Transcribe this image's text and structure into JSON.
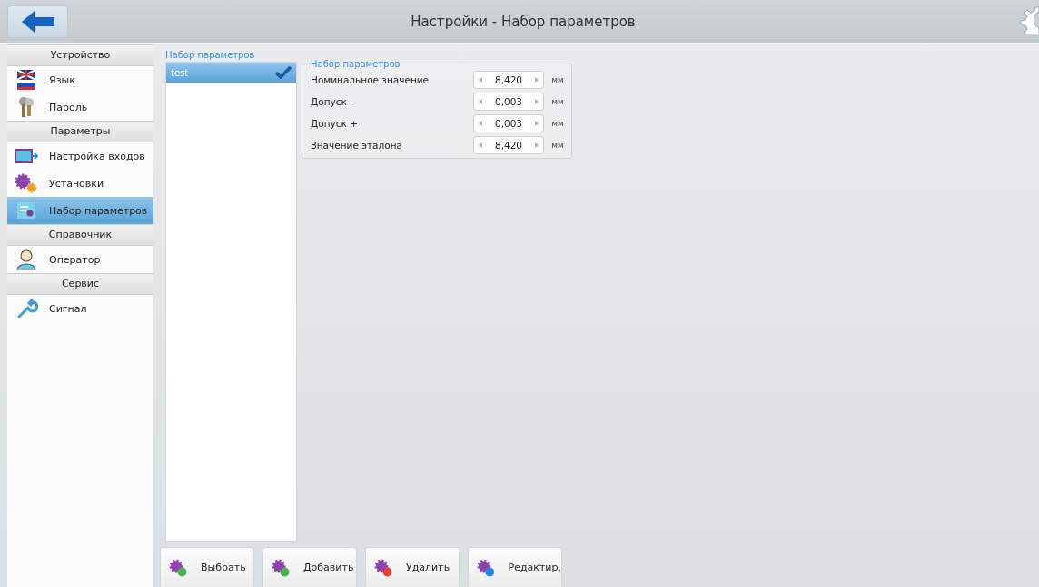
{
  "header": {
    "title": "Настройки - Набор параметров"
  },
  "sidebar": {
    "items": [
      {
        "kind": "header",
        "label": "Устройство"
      },
      {
        "kind": "item",
        "label": "Язык",
        "selected": false
      },
      {
        "kind": "item",
        "label": "Пароль",
        "selected": false
      },
      {
        "kind": "header",
        "label": "Параметры"
      },
      {
        "kind": "item",
        "label": "Настройка входов",
        "selected": false
      },
      {
        "kind": "item",
        "label": "Установки",
        "selected": false
      },
      {
        "kind": "item",
        "label": "Набор параметров",
        "selected": true
      },
      {
        "kind": "header",
        "label": "Справочник"
      },
      {
        "kind": "item",
        "label": "Оператор",
        "selected": false
      },
      {
        "kind": "header",
        "label": "Сервис"
      },
      {
        "kind": "item",
        "label": "Сигнал",
        "selected": false
      }
    ]
  },
  "sets": {
    "title": "Набор параметров",
    "items": [
      {
        "label": "test",
        "selected": true,
        "checked": true
      }
    ]
  },
  "params": {
    "title": "Набор параметров",
    "rows": [
      {
        "label": "Номинальное значение",
        "value": "8,420",
        "unit": "мм"
      },
      {
        "label": "Допуск -",
        "value": "0,003",
        "unit": "мм"
      },
      {
        "label": "Допуск +",
        "value": "0,003",
        "unit": "мм"
      },
      {
        "label": "Значение эталона",
        "value": "8,420",
        "unit": "мм"
      }
    ]
  },
  "buttons": [
    {
      "label": "Выбрать",
      "kind": "select"
    },
    {
      "label": "Добавить",
      "kind": "add"
    },
    {
      "label": "Удалить",
      "kind": "delete"
    },
    {
      "label": "Редактир.",
      "kind": "edit"
    }
  ]
}
